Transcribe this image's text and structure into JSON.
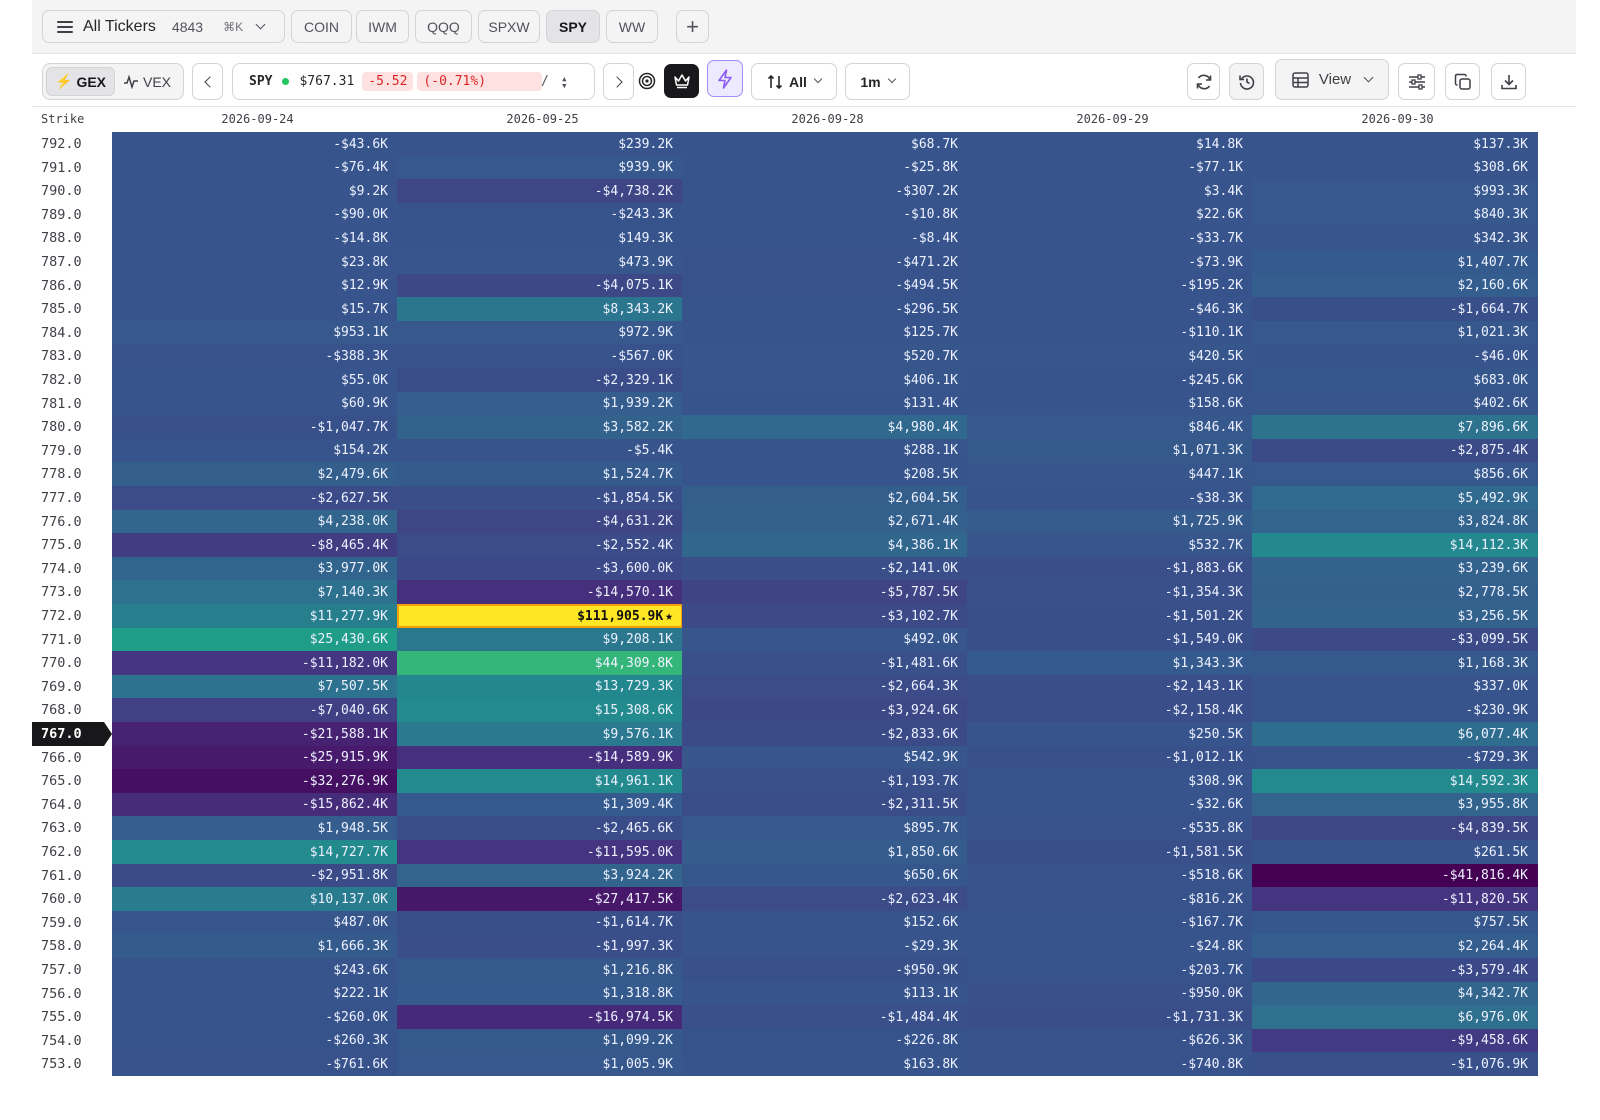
{
  "tabs_bar": {
    "all_tickers_label": "All Tickers",
    "all_tickers_count": "4843",
    "shortcut": "⌘K",
    "tickers": [
      "COIN",
      "IWM",
      "QQQ",
      "SPXW",
      "SPY",
      "WW"
    ],
    "active_ticker": "SPY"
  },
  "toolbar": {
    "gex_label": "GEX",
    "vex_label": "VEX",
    "symbol": "SPY",
    "price": "$767.31",
    "change": "-5.52",
    "change_pct": "(-0.71%)",
    "slash": "/",
    "filter_label": "All",
    "interval_label": "1m",
    "view_label": "View"
  },
  "colors": {
    "accent_violet": "#8b5cf6",
    "up_green": "#22c55e",
    "down_red": "#dc2626",
    "max_highlight": "#fde725"
  },
  "grid": {
    "strike_header": "Strike",
    "expiries": [
      "2026-09-24",
      "2026-09-25",
      "2026-09-28",
      "2026-09-29",
      "2026-09-30"
    ],
    "current_strike": "767.0",
    "max_cell_marker": "★",
    "rows": [
      {
        "strike": "792.0",
        "values": [
          "-$43.6K",
          "$239.2K",
          "$68.7K",
          "$14.8K",
          "$137.3K"
        ]
      },
      {
        "strike": "791.0",
        "values": [
          "-$76.4K",
          "$939.9K",
          "-$25.8K",
          "-$77.1K",
          "$308.6K"
        ]
      },
      {
        "strike": "790.0",
        "values": [
          "$9.2K",
          "-$4,738.2K",
          "-$307.2K",
          "$3.4K",
          "$993.3K"
        ]
      },
      {
        "strike": "789.0",
        "values": [
          "-$90.0K",
          "-$243.3K",
          "-$10.8K",
          "$22.6K",
          "$840.3K"
        ]
      },
      {
        "strike": "788.0",
        "values": [
          "-$14.8K",
          "$149.3K",
          "-$8.4K",
          "-$33.7K",
          "$342.3K"
        ]
      },
      {
        "strike": "787.0",
        "values": [
          "$23.8K",
          "$473.9K",
          "-$471.2K",
          "-$73.9K",
          "$1,407.7K"
        ]
      },
      {
        "strike": "786.0",
        "values": [
          "$12.9K",
          "-$4,075.1K",
          "-$494.5K",
          "-$195.2K",
          "$2,160.6K"
        ]
      },
      {
        "strike": "785.0",
        "values": [
          "$15.7K",
          "$8,343.2K",
          "-$296.5K",
          "-$46.3K",
          "-$1,664.7K"
        ]
      },
      {
        "strike": "784.0",
        "values": [
          "$953.1K",
          "$972.9K",
          "$125.7K",
          "-$110.1K",
          "$1,021.3K"
        ]
      },
      {
        "strike": "783.0",
        "values": [
          "-$388.3K",
          "-$567.0K",
          "$520.7K",
          "$420.5K",
          "-$46.0K"
        ]
      },
      {
        "strike": "782.0",
        "values": [
          "$55.0K",
          "-$2,329.1K",
          "$406.1K",
          "-$245.6K",
          "$683.0K"
        ]
      },
      {
        "strike": "781.0",
        "values": [
          "$60.9K",
          "$1,939.2K",
          "$131.4K",
          "$158.6K",
          "$402.6K"
        ]
      },
      {
        "strike": "780.0",
        "values": [
          "-$1,047.7K",
          "$3,582.2K",
          "$4,980.4K",
          "$846.4K",
          "$7,896.6K"
        ]
      },
      {
        "strike": "779.0",
        "values": [
          "$154.2K",
          "-$5.4K",
          "$288.1K",
          "$1,071.3K",
          "-$2,875.4K"
        ]
      },
      {
        "strike": "778.0",
        "values": [
          "$2,479.6K",
          "$1,524.7K",
          "$208.5K",
          "$447.1K",
          "$856.6K"
        ]
      },
      {
        "strike": "777.0",
        "values": [
          "-$2,627.5K",
          "-$1,854.5K",
          "$2,604.5K",
          "-$38.3K",
          "$5,492.9K"
        ]
      },
      {
        "strike": "776.0",
        "values": [
          "$4,238.0K",
          "-$4,631.2K",
          "$2,671.4K",
          "$1,725.9K",
          "$3,824.8K"
        ]
      },
      {
        "strike": "775.0",
        "values": [
          "-$8,465.4K",
          "-$2,552.4K",
          "$4,386.1K",
          "$532.7K",
          "$14,112.3K"
        ]
      },
      {
        "strike": "774.0",
        "values": [
          "$3,977.0K",
          "-$3,600.0K",
          "-$2,141.0K",
          "-$1,883.6K",
          "$3,239.6K"
        ]
      },
      {
        "strike": "773.0",
        "values": [
          "$7,140.3K",
          "-$14,570.1K",
          "-$5,787.5K",
          "-$1,354.3K",
          "$2,778.5K"
        ]
      },
      {
        "strike": "772.0",
        "values": [
          "$11,277.9K",
          "$111,905.9K",
          "-$3,102.7K",
          "-$1,501.2K",
          "$3,256.5K"
        ]
      },
      {
        "strike": "771.0",
        "values": [
          "$25,430.6K",
          "$9,208.1K",
          "$492.0K",
          "-$1,549.0K",
          "-$3,099.5K"
        ]
      },
      {
        "strike": "770.0",
        "values": [
          "-$11,182.0K",
          "$44,309.8K",
          "-$1,481.6K",
          "$1,343.3K",
          "$1,168.3K"
        ]
      },
      {
        "strike": "769.0",
        "values": [
          "$7,507.5K",
          "$13,729.3K",
          "-$2,664.3K",
          "-$2,143.1K",
          "$337.0K"
        ]
      },
      {
        "strike": "768.0",
        "values": [
          "-$7,040.6K",
          "$15,308.6K",
          "-$3,924.6K",
          "-$2,158.4K",
          "-$230.9K"
        ]
      },
      {
        "strike": "767.0",
        "values": [
          "-$21,588.1K",
          "$9,576.1K",
          "-$2,833.6K",
          "$250.5K",
          "$6,077.4K"
        ]
      },
      {
        "strike": "766.0",
        "values": [
          "-$25,915.9K",
          "-$14,589.9K",
          "$542.9K",
          "-$1,012.1K",
          "-$729.3K"
        ]
      },
      {
        "strike": "765.0",
        "values": [
          "-$32,276.9K",
          "$14,961.1K",
          "-$1,193.7K",
          "$308.9K",
          "$14,592.3K"
        ]
      },
      {
        "strike": "764.0",
        "values": [
          "-$15,862.4K",
          "$1,309.4K",
          "-$2,311.5K",
          "-$32.6K",
          "$3,955.8K"
        ]
      },
      {
        "strike": "763.0",
        "values": [
          "$1,948.5K",
          "-$2,465.6K",
          "$895.7K",
          "-$535.8K",
          "-$4,839.5K"
        ]
      },
      {
        "strike": "762.0",
        "values": [
          "$14,727.7K",
          "-$11,595.0K",
          "$1,850.6K",
          "-$1,581.5K",
          "$261.5K"
        ]
      },
      {
        "strike": "761.0",
        "values": [
          "-$2,951.8K",
          "$3,924.2K",
          "$650.6K",
          "-$518.6K",
          "-$41,816.4K"
        ]
      },
      {
        "strike": "760.0",
        "values": [
          "$10,137.0K",
          "-$27,417.5K",
          "-$2,623.4K",
          "-$816.2K",
          "-$11,820.5K"
        ]
      },
      {
        "strike": "759.0",
        "values": [
          "$487.0K",
          "-$1,614.7K",
          "$152.6K",
          "-$167.7K",
          "$757.5K"
        ]
      },
      {
        "strike": "758.0",
        "values": [
          "$1,666.3K",
          "-$1,997.3K",
          "-$29.3K",
          "-$24.8K",
          "$2,264.4K"
        ]
      },
      {
        "strike": "757.0",
        "values": [
          "$243.6K",
          "$1,216.8K",
          "-$950.9K",
          "-$203.7K",
          "-$3,579.4K"
        ]
      },
      {
        "strike": "756.0",
        "values": [
          "$222.1K",
          "$1,318.8K",
          "$113.1K",
          "-$950.0K",
          "$4,342.7K"
        ]
      },
      {
        "strike": "755.0",
        "values": [
          "-$260.0K",
          "-$16,974.5K",
          "-$1,484.4K",
          "-$1,731.3K",
          "$6,976.0K"
        ]
      },
      {
        "strike": "754.0",
        "values": [
          "-$260.3K",
          "$1,099.2K",
          "-$226.8K",
          "-$626.3K",
          "-$9,458.6K"
        ]
      },
      {
        "strike": "753.0",
        "values": [
          "-$761.6K",
          "$1,005.9K",
          "$163.8K",
          "-$740.8K",
          "-$1,076.9K"
        ]
      }
    ]
  }
}
